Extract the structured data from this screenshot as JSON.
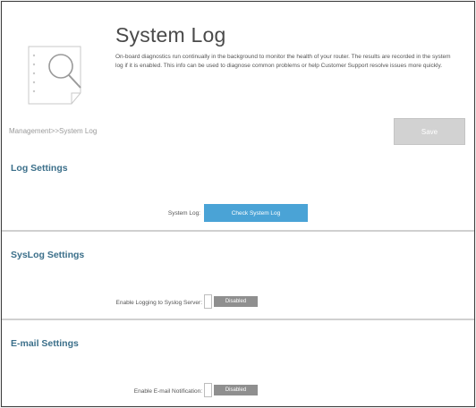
{
  "header": {
    "title": "System Log",
    "description": "On-board diagnostics run continually in the background to monitor the health of your router. The results are recorded in the system log if it is enabled. This info can be used to diagnose common problems or help Customer Support resolve issues more quickly."
  },
  "breadcrumb": "Management>>System Log",
  "toolbar": {
    "save_label": "Save"
  },
  "log_settings": {
    "title": "Log Settings",
    "system_log_label": "System Log:",
    "check_button_label": "Check System Log"
  },
  "syslog_settings": {
    "title": "SysLog Settings",
    "enable_label": "Enable Logging to Syslog Server:",
    "toggle_state": "Disabled"
  },
  "email_settings": {
    "title": "E-mail Settings",
    "enable_label": "Enable E-mail Notification:",
    "toggle_state": "Disabled"
  },
  "icons": {
    "header_icon": "document-search-icon"
  },
  "colors": {
    "accent_blue": "#4aa3d6",
    "section_title": "#3b6f8a",
    "save_disabled": "#d2d2d2",
    "toggle_disabled": "#8f8f8f"
  }
}
